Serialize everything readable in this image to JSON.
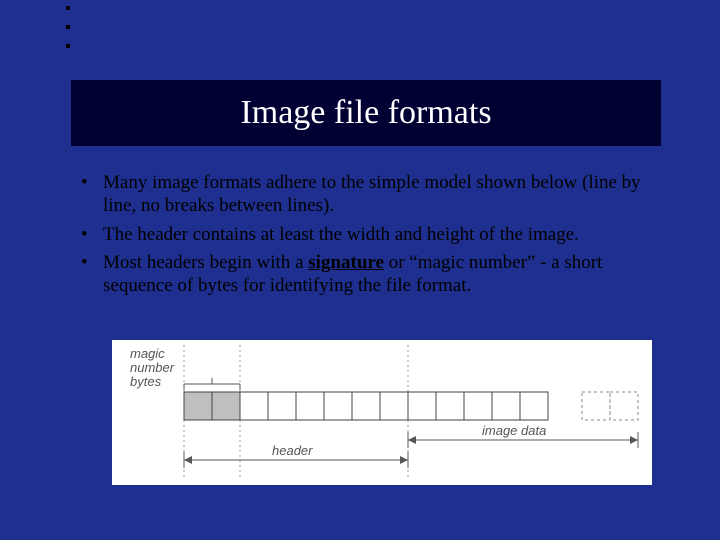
{
  "title": "Image file formats",
  "bullets": [
    {
      "pre": "Many image formats adhere to the simple model shown below (line by line, no breaks between lines)."
    },
    {
      "pre": "The header contains at least the width and height of the image."
    },
    {
      "pre": "Most headers begin with a ",
      "sig": "signature",
      "post": " or “magic number” - a short sequence of bytes for identifying the file format."
    }
  ],
  "diagram": {
    "magic_label_l1": "magic",
    "magic_label_l2": "number",
    "magic_label_l3": "bytes",
    "header_label": "header",
    "image_data_label": "image data"
  }
}
